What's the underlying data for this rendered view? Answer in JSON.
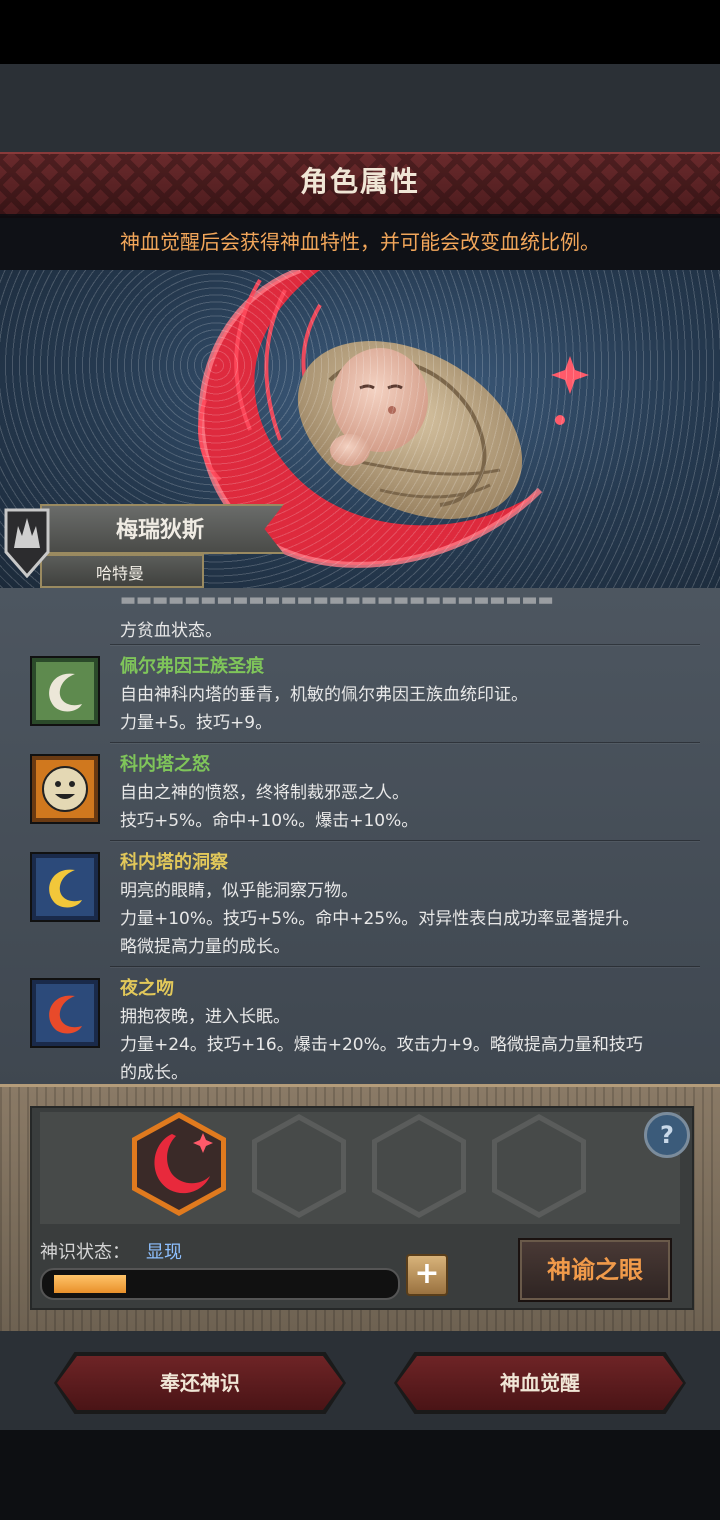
{
  "header": {
    "title": "角色属性",
    "subtitle": "神血觉醒后会获得神血特性，并可能会改变血统比例。"
  },
  "character": {
    "name": "梅瑞狄斯",
    "origin": "哈特曼"
  },
  "traits": {
    "partial_line": "方贫血状态。",
    "items": [
      {
        "name": "佩尔弗因王族圣痕",
        "name_color": "#7fc55a",
        "desc": "自由神科内塔的垂青，机敏的佩尔弗因王族血统印证。",
        "stats": "力量+5。技巧+9。",
        "extra": "",
        "icon": "swirl-white-icon"
      },
      {
        "name": "科内塔之怒",
        "name_color": "#7fc55a",
        "desc": "自由之神的愤怒，终将制裁邪恶之人。",
        "stats": "技巧+5%。命中+10%。爆击+10%。",
        "extra": "",
        "icon": "smiling-sun-icon"
      },
      {
        "name": "科内塔的洞察",
        "name_color": "#e2c85a",
        "desc": "明亮的眼睛，似乎能洞察万物。",
        "stats": "力量+10%。技巧+5%。命中+25%。对异性表白成功率显著提升。",
        "extra": "略微提高力量的成长。",
        "icon": "swirl-yellow-icon"
      },
      {
        "name": "夜之吻",
        "name_color": "#e2c85a",
        "desc": "拥抱夜晚，进入长眠。",
        "stats": "力量+24。技巧+16。爆击+20%。攻击力+9。略微提高力量和技巧",
        "extra": "的成长。",
        "icon": "swirl-red-icon"
      }
    ]
  },
  "divine": {
    "status_label": "神识状态：",
    "status_value": "显现",
    "progress": 0.22,
    "help_label": "?",
    "plus_label": "+",
    "oracle_label": "神谕之眼"
  },
  "buttons": {
    "return_label": "奉还神识",
    "awaken_label": "神血觉醒"
  }
}
